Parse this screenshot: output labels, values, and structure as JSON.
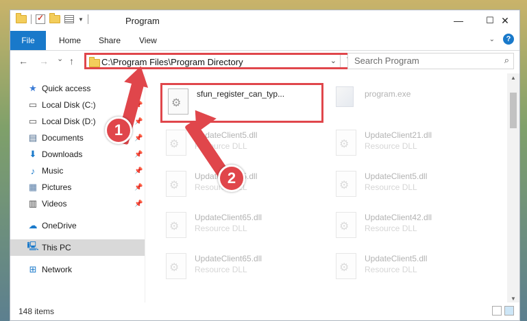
{
  "window": {
    "title": "Program",
    "controls": {
      "minimize": "—",
      "maximize": "☐",
      "close": "✕"
    }
  },
  "ribbon": {
    "tabs": [
      "File",
      "Home",
      "Share",
      "View"
    ],
    "help_icon": "question-icon",
    "accent": "#1979ca"
  },
  "navigation": {
    "back": "←",
    "forward": "→",
    "recent": "⌄",
    "up": "↑",
    "address_path": "C:\\Program Files\\Program Directory",
    "address_dropdown": "⌄",
    "refresh": "↻",
    "search_placeholder": "Search Program",
    "search_icon": "⌕"
  },
  "sidebar": {
    "items": [
      {
        "label": "Quick access",
        "icon": "star-icon",
        "glyph": "★",
        "color": "#3a7bd5",
        "pinned": false
      },
      {
        "label": "Local Disk (C:)",
        "icon": "drive-icon",
        "glyph": "▭",
        "color": "#555",
        "pinned": true
      },
      {
        "label": "Local Disk (D:)",
        "icon": "drive-icon",
        "glyph": "▭",
        "color": "#555",
        "pinned": true
      },
      {
        "label": "Documents",
        "icon": "documents-icon",
        "glyph": "▤",
        "color": "#4d6c8f",
        "pinned": true
      },
      {
        "label": "Downloads",
        "icon": "download-icon",
        "glyph": "⬇",
        "color": "#1979ca",
        "pinned": true
      },
      {
        "label": "Music",
        "icon": "music-icon",
        "glyph": "♪",
        "color": "#1979ca",
        "pinned": true
      },
      {
        "label": "Pictures",
        "icon": "pictures-icon",
        "glyph": "▦",
        "color": "#5a7fa8",
        "pinned": true
      },
      {
        "label": "Videos",
        "icon": "videos-icon",
        "glyph": "▥",
        "color": "#444",
        "pinned": true
      },
      {
        "label": "OneDrive",
        "icon": "cloud-icon",
        "glyph": "☁",
        "color": "#1979ca",
        "pinned": false
      },
      {
        "label": "This PC",
        "icon": "computer-icon",
        "glyph": "🖳",
        "color": "#1979ca",
        "pinned": false,
        "selected": true
      },
      {
        "label": "Network",
        "icon": "network-icon",
        "glyph": "⊞",
        "color": "#1979ca",
        "pinned": false
      }
    ],
    "pin_glyph": "📌"
  },
  "files": [
    {
      "name": "sfun_register_can_typ...",
      "type": "",
      "highlighted": true,
      "faded": false
    },
    {
      "name": "program.exe",
      "type": "",
      "highlighted": false,
      "faded": true,
      "exe": true
    },
    {
      "name": "UpdateClient5.dll",
      "type": "Resource DLL",
      "faded": true
    },
    {
      "name": "UpdateClient21.dll",
      "type": "Resource DLL",
      "faded": true
    },
    {
      "name": "UpdateClient5.dll",
      "type": "Resource DLL",
      "faded": true
    },
    {
      "name": "UpdateClient5.dll",
      "type": "Resource DLL",
      "faded": true
    },
    {
      "name": "UpdateClient65.dll",
      "type": "Resource DLL",
      "faded": true
    },
    {
      "name": "UpdateClient42.dll",
      "type": "Resource DLL",
      "faded": true
    },
    {
      "name": "UpdateClient65.dll",
      "type": "Resource DLL",
      "faded": true
    },
    {
      "name": "UpdateClient5.dll",
      "type": "Resource DLL",
      "faded": true
    }
  ],
  "status": {
    "item_count": "148 items"
  },
  "annotations": {
    "step1": "1",
    "step2": "2",
    "color": "#e0464b"
  }
}
